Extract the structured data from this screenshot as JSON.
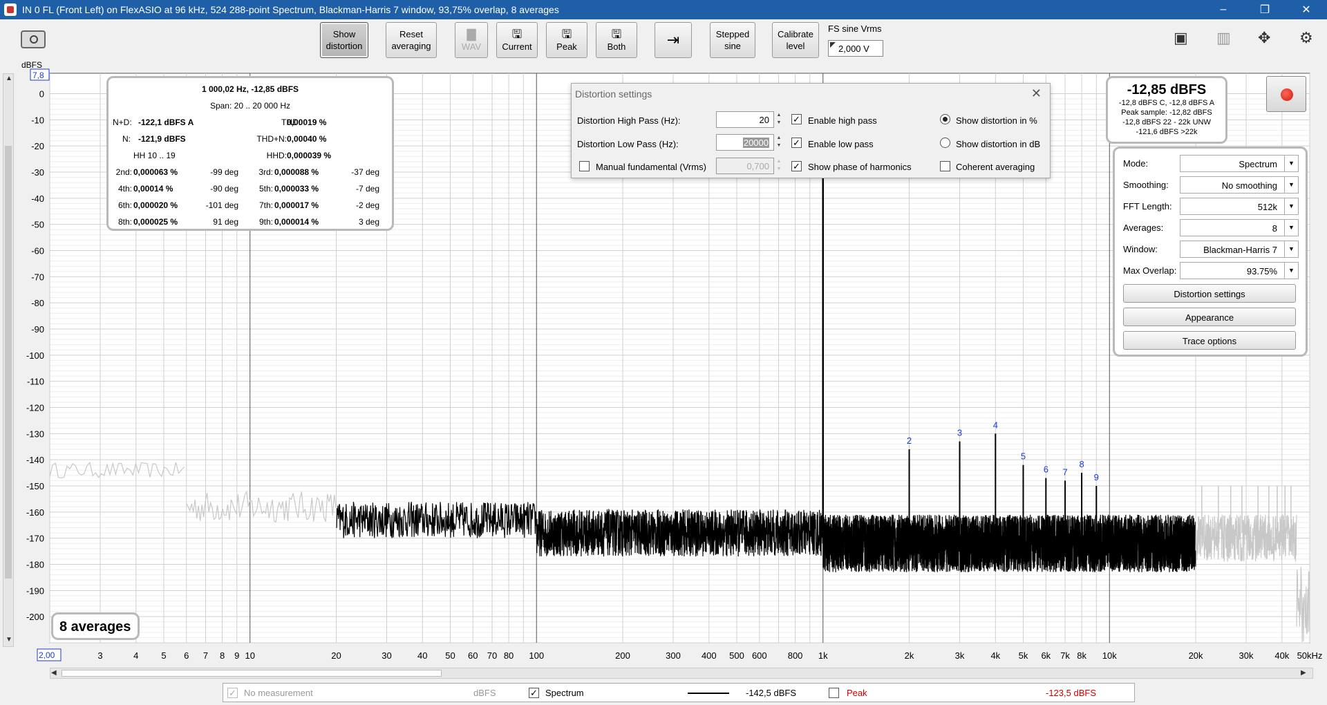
{
  "title": "IN 0 FL (Front Left) on FlexASIO at 96 kHz, 524 288-point Spectrum, Blackman-Harris 7 window, 93,75% overlap, 8 averages",
  "window_controls": {
    "minimize": "–",
    "restore": "❐",
    "close": "✕"
  },
  "toolbar": {
    "show_distortion": [
      "Show",
      "distortion"
    ],
    "reset_averaging": [
      "Reset",
      "averaging"
    ],
    "wav": "WAV",
    "current": "Current",
    "peak": "Peak",
    "both": "Both",
    "stepped_sine": [
      "Stepped",
      "sine"
    ],
    "calibrate_level": [
      "Calibrate",
      "level"
    ],
    "fs_sine_label": "FS sine Vrms",
    "fs_sine_value": "2,000 V"
  },
  "plot": {
    "y_unit": "dBFS",
    "y_top": "7,8",
    "x_left": "2,00",
    "y_ticks": [
      "0",
      "-10",
      "-20",
      "-30",
      "-40",
      "-50",
      "-60",
      "-70",
      "-80",
      "-90",
      "-100",
      "-110",
      "-120",
      "-130",
      "-140",
      "-150",
      "-160",
      "-170",
      "-180",
      "-190",
      "-200"
    ],
    "x_ticks": [
      "3",
      "4",
      "5",
      "6",
      "7",
      "8",
      "9",
      "10",
      "20",
      "30",
      "40",
      "50",
      "60",
      "70",
      "80",
      "100",
      "200",
      "300",
      "400",
      "500",
      "600",
      "800",
      "1k",
      "2k",
      "3k",
      "4k",
      "5k",
      "6k",
      "7k",
      "8k",
      "10k",
      "20k",
      "30k",
      "40k",
      "50kHz"
    ],
    "harmonic_labels": [
      "2",
      "3",
      "4",
      "5",
      "6",
      "7",
      "8",
      "9"
    ],
    "averages_badge": "8 averages"
  },
  "chart_data": {
    "type": "line",
    "xlabel": "",
    "ylabel": "dBFS",
    "x_scale": "log",
    "xlim": [
      2,
      50000
    ],
    "ylim": [
      -210,
      7.8
    ],
    "grid": true,
    "series": [
      {
        "name": "Spectrum",
        "style": "black noise floor about -165 to -175 dBFS between 20 Hz and 20 kHz, grey outside",
        "peaks": [
          {
            "x": 1000,
            "y": -12.85
          },
          {
            "x": 2000,
            "y": -136
          },
          {
            "x": 3000,
            "y": -133
          },
          {
            "x": 4000,
            "y": -130
          },
          {
            "x": 5000,
            "y": -142
          },
          {
            "x": 6000,
            "y": -147
          },
          {
            "x": 7000,
            "y": -148
          },
          {
            "x": 8000,
            "y": -145
          },
          {
            "x": 9000,
            "y": -150
          }
        ]
      }
    ],
    "legend": [
      {
        "label": "No measurement",
        "unit": "dBFS",
        "checked": true,
        "disabled": true
      },
      {
        "label": "Spectrum",
        "value": "-142,5 dBFS",
        "checked": true
      },
      {
        "label": "Peak",
        "value": "-123,5 dBFS",
        "checked": false
      }
    ]
  },
  "distortion_panel": {
    "header": "1 000,02 Hz, -12,85 dBFS",
    "span": "Span: 20 .. 20 000 Hz",
    "nd_label": "N+D:",
    "nd_value": "-122,1 dBFS A",
    "thd_label": "THD:",
    "thd_value": "0,00019 %",
    "n_label": "N:",
    "n_value": "-121,9 dBFS",
    "thdn_label": "THD+N:",
    "thdn_value": "0,00040 %",
    "hh_label": "HH 10 .. 19",
    "hhd_label": "HHD:",
    "hhd_value": "0,000039 %",
    "harmonics": [
      {
        "label": "2nd:",
        "value": "0,000063 %",
        "phase": "-99 deg"
      },
      {
        "label": "3rd:",
        "value": "0,000088 %",
        "phase": "-37 deg"
      },
      {
        "label": "4th:",
        "value": "0,00014 %",
        "phase": "-90 deg"
      },
      {
        "label": "5th:",
        "value": "0,000033 %",
        "phase": "-7 deg"
      },
      {
        "label": "6th:",
        "value": "0,000020 %",
        "phase": "-101 deg"
      },
      {
        "label": "7th:",
        "value": "0,000017 %",
        "phase": "-2 deg"
      },
      {
        "label": "8th:",
        "value": "0,000025 %",
        "phase": "91 deg"
      },
      {
        "label": "9th:",
        "value": "0,000014 %",
        "phase": "3 deg"
      }
    ]
  },
  "dialog": {
    "title": "Distortion settings",
    "high_pass_label": "Distortion High Pass (Hz):",
    "high_pass_value": "20",
    "low_pass_label": "Distortion Low Pass (Hz):",
    "low_pass_value": "20000",
    "manual_fundamental_label": "Manual fundamental (Vrms)",
    "manual_fundamental_value": "0,700",
    "enable_high_pass": "Enable high pass",
    "enable_low_pass": "Enable low pass",
    "show_phase": "Show phase of harmonics",
    "show_pct": "Show distortion in %",
    "show_db": "Show distortion in dB",
    "coherent": "Coherent averaging"
  },
  "level_meter": {
    "main": "-12,85 dBFS",
    "line1": "-12,8 dBFS C, -12,8 dBFS A",
    "line2": "Peak sample: -12,82 dBFS",
    "line3": "-12,8 dBFS 22 - 22k UNW",
    "line4": "-121,6 dBFS >22k"
  },
  "settings": {
    "mode_label": "Mode:",
    "mode_value": "Spectrum",
    "smoothing_label": "Smoothing:",
    "smoothing_value": "No  smoothing",
    "fft_label": "FFT Length:",
    "fft_value": "512k",
    "averages_label": "Averages:",
    "averages_value": "8",
    "window_label": "Window:",
    "window_value": "Blackman-Harris 7",
    "overlap_label": "Max Overlap:",
    "overlap_value": "93.75%",
    "distortion_settings_btn": "Distortion settings",
    "appearance_btn": "Appearance",
    "trace_options_btn": "Trace options"
  }
}
